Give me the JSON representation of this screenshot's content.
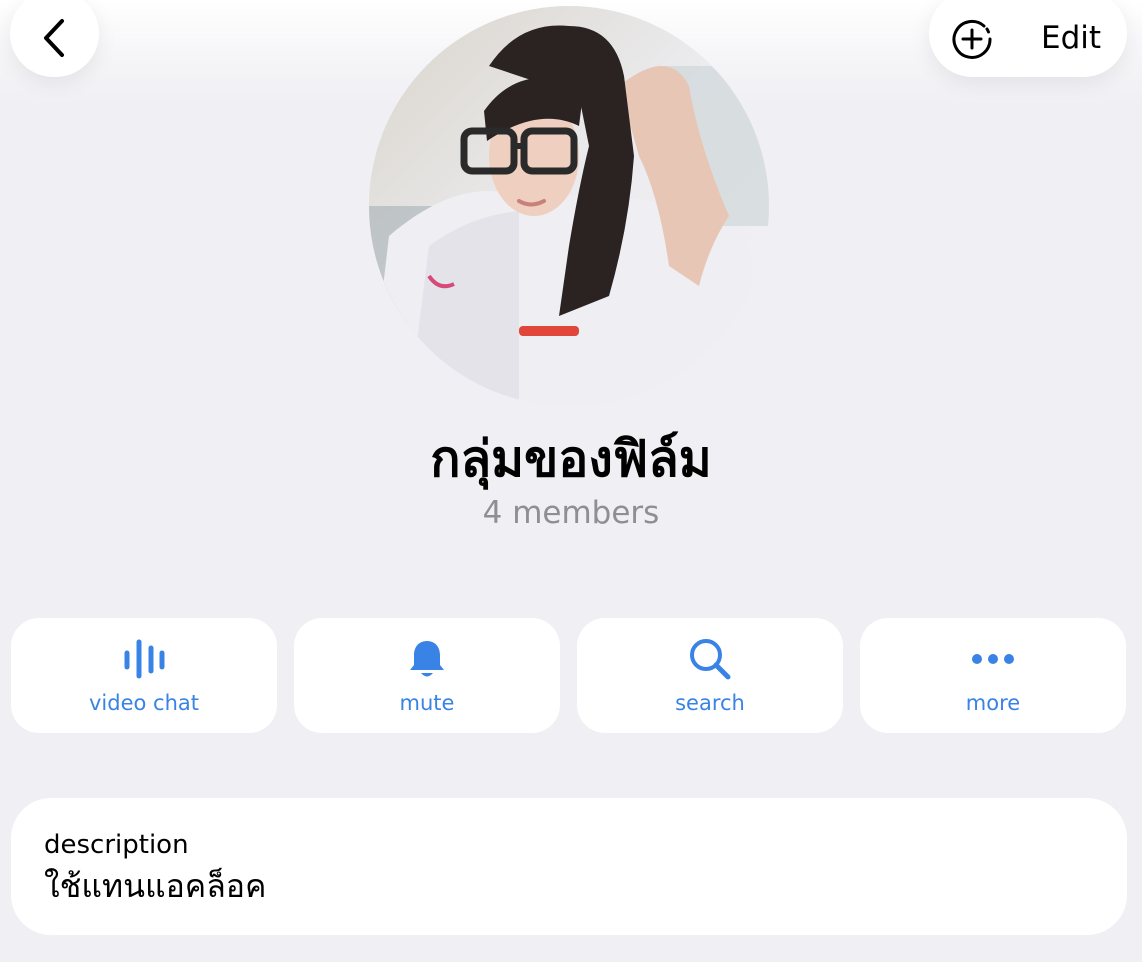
{
  "header": {
    "back_icon": "chevron-left-icon",
    "add_story_icon": "plus-circle-dashed-icon",
    "edit_label": "Edit"
  },
  "profile": {
    "group_name": "กลุ่มของฟิล์ม",
    "member_count": "4 members"
  },
  "actions": [
    {
      "label": "video chat",
      "icon": "voice-chat-bars-icon"
    },
    {
      "label": "mute",
      "icon": "bell-icon"
    },
    {
      "label": "search",
      "icon": "search-icon"
    },
    {
      "label": "more",
      "icon": "more-dots-icon"
    }
  ],
  "description": {
    "title": "description",
    "text": "ใช้แทนแอคล็อค"
  },
  "colors": {
    "background": "#efeff4",
    "card": "#ffffff",
    "accent": "#3a83e6",
    "secondary_text": "#8e8e93"
  }
}
